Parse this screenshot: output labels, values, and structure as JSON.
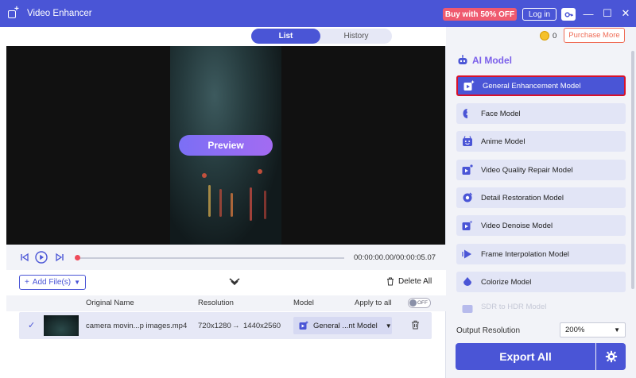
{
  "app": {
    "title": "Video Enhancer"
  },
  "titlebar": {
    "buy_label": "Buy with 50% OFF",
    "login_label": "Log in",
    "minimize_glyph": "—",
    "maximize_glyph": "☐",
    "close_glyph": "✕"
  },
  "tabs": [
    {
      "label": "List",
      "active": true
    },
    {
      "label": "History",
      "active": false
    }
  ],
  "preview": {
    "button_label": "Preview"
  },
  "player": {
    "time": "00:00:00.00/00:00:05.07",
    "progress": 0
  },
  "file_toolbar": {
    "add_label": "Add File(s)",
    "delete_all_label": "Delete All"
  },
  "table": {
    "headers": {
      "name": "Original Name",
      "resolution": "Resolution",
      "model": "Model",
      "apply_all": "Apply to all",
      "toggle": "OFF"
    },
    "rows": [
      {
        "name": "camera movin...p images.mp4",
        "res_from": "720x1280",
        "arrow": "→",
        "res_to": "1440x2560",
        "model": "General ...nt Model"
      }
    ]
  },
  "right_panel": {
    "credits": "0",
    "purchase_label": "Purchase More",
    "section_title": "AI Model",
    "models": [
      {
        "label": "General Enhancement Model",
        "icon": "video-plus-icon",
        "active": true
      },
      {
        "label": "Face Model",
        "icon": "face-icon",
        "active": false
      },
      {
        "label": "Anime Model",
        "icon": "anime-icon",
        "active": false
      },
      {
        "label": "Video Quality Repair Model",
        "icon": "video-repair-icon",
        "active": false
      },
      {
        "label": "Detail Restoration Model",
        "icon": "detail-icon",
        "active": false
      },
      {
        "label": "Video Denoise Model",
        "icon": "denoise-icon",
        "active": false
      },
      {
        "label": "Frame Interpolation Model",
        "icon": "frame-icon",
        "active": false
      },
      {
        "label": "Colorize Model",
        "icon": "colorize-icon",
        "active": false
      },
      {
        "label": "SDR to HDR Model",
        "icon": "hdr-icon",
        "active": false
      }
    ],
    "output_resolution_label": "Output Resolution",
    "output_resolution_value": "200%",
    "export_label": "Export All"
  },
  "colors": {
    "primary": "#4a55d6",
    "accent_red": "#ef5a6f",
    "preview_gradient_start": "#7b6ff5",
    "preview_gradient_end": "#a36bf2",
    "highlight_border": "#d8112a"
  }
}
